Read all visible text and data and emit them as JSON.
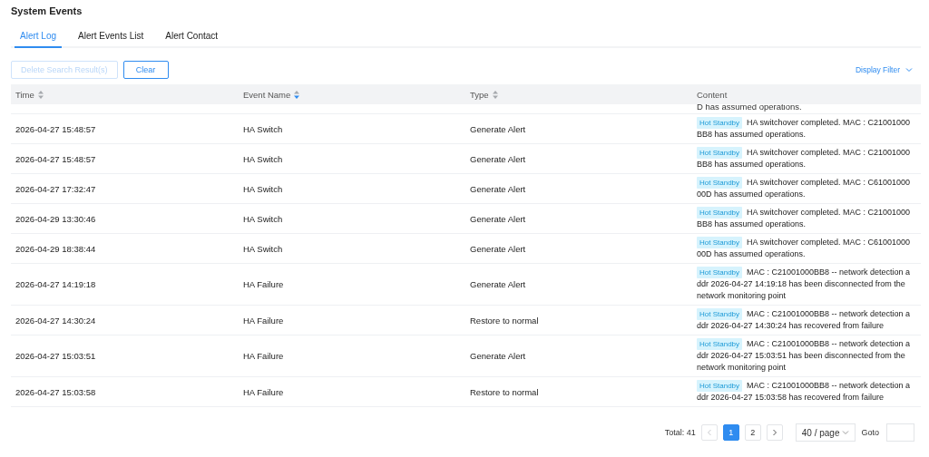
{
  "page": {
    "title": "System Events"
  },
  "tabs": [
    {
      "label": "Alert Log",
      "selected": true
    },
    {
      "label": "Alert Events List",
      "selected": false
    },
    {
      "label": "Alert Contact",
      "selected": false
    }
  ],
  "toolbar": {
    "buttons": [
      {
        "label": "Delete Search Result(s)",
        "disabled": true
      },
      {
        "label": "Clear",
        "disabled": false
      }
    ],
    "filter": {
      "label": "Display Filter"
    }
  },
  "table": {
    "columns": [
      {
        "label": "Time",
        "sort_desc": false
      },
      {
        "label": "Event Name",
        "sort_desc": true
      },
      {
        "label": "Type",
        "sort_desc": false
      },
      {
        "label": "Content"
      }
    ],
    "rows": [
      {
        "kind": "partial",
        "content": "D has assumed operations."
      },
      {
        "kind": "full",
        "time": "2026-04-27 15:48:57",
        "event": "HA Switch",
        "type": "Generate Alert",
        "tag": "Hot Standby",
        "content": "HA switchover completed. MAC : C21001000BB8 has assumed operations."
      },
      {
        "kind": "full",
        "time": "2026-04-27 15:48:57",
        "event": "HA Switch",
        "type": "Generate Alert",
        "tag": "Hot Standby",
        "content": "HA switchover completed. MAC : C21001000BB8 has assumed operations."
      },
      {
        "kind": "full",
        "time": "2026-04-27 17:32:47",
        "event": "HA Switch",
        "type": "Generate Alert",
        "tag": "Hot Standby",
        "content": "HA switchover completed. MAC : C6100100000D has assumed operations."
      },
      {
        "kind": "full",
        "time": "2026-04-29 13:30:46",
        "event": "HA Switch",
        "type": "Generate Alert",
        "tag": "Hot Standby",
        "content": "HA switchover completed. MAC : C21001000BB8 has assumed operations."
      },
      {
        "kind": "full",
        "time": "2026-04-29 18:38:44",
        "event": "HA Switch",
        "type": "Generate Alert",
        "tag": "Hot Standby",
        "content": "HA switchover completed. MAC : C6100100000D has assumed operations."
      },
      {
        "kind": "full",
        "time": "2026-04-27 14:19:18",
        "event": "HA Failure",
        "type": "Generate Alert",
        "tag": "Hot Standby",
        "content": "MAC : C21001000BB8 -- network detection addr 2026-04-27 14:19:18 has been disconnected from the network monitoring point"
      },
      {
        "kind": "full",
        "time": "2026-04-27 14:30:24",
        "event": "HA Failure",
        "type": "Restore to normal",
        "tag": "Hot Standby",
        "content": "MAC : C21001000BB8 -- network detection addr 2026-04-27 14:30:24 has recovered from failure"
      },
      {
        "kind": "full",
        "time": "2026-04-27 15:03:51",
        "event": "HA Failure",
        "type": "Generate Alert",
        "tag": "Hot Standby",
        "content": "MAC : C21001000BB8 -- network detection addr 2026-04-27 15:03:51 has been disconnected from the network monitoring point"
      },
      {
        "kind": "full",
        "time": "2026-04-27 15:03:58",
        "event": "HA Failure",
        "type": "Restore to normal",
        "tag": "Hot Standby",
        "content": "MAC : C21001000BB8 -- network detection addr 2026-04-27 15:03:58 has recovered from failure"
      }
    ]
  },
  "pagination": {
    "total": "Total: 41",
    "prev": {
      "disabled": true
    },
    "pages": [
      {
        "label": "1",
        "selected": true
      },
      {
        "label": "2",
        "selected": false
      }
    ],
    "next": {
      "disabled": false
    },
    "page_size": "40 / page",
    "goto_label": "Goto"
  }
}
